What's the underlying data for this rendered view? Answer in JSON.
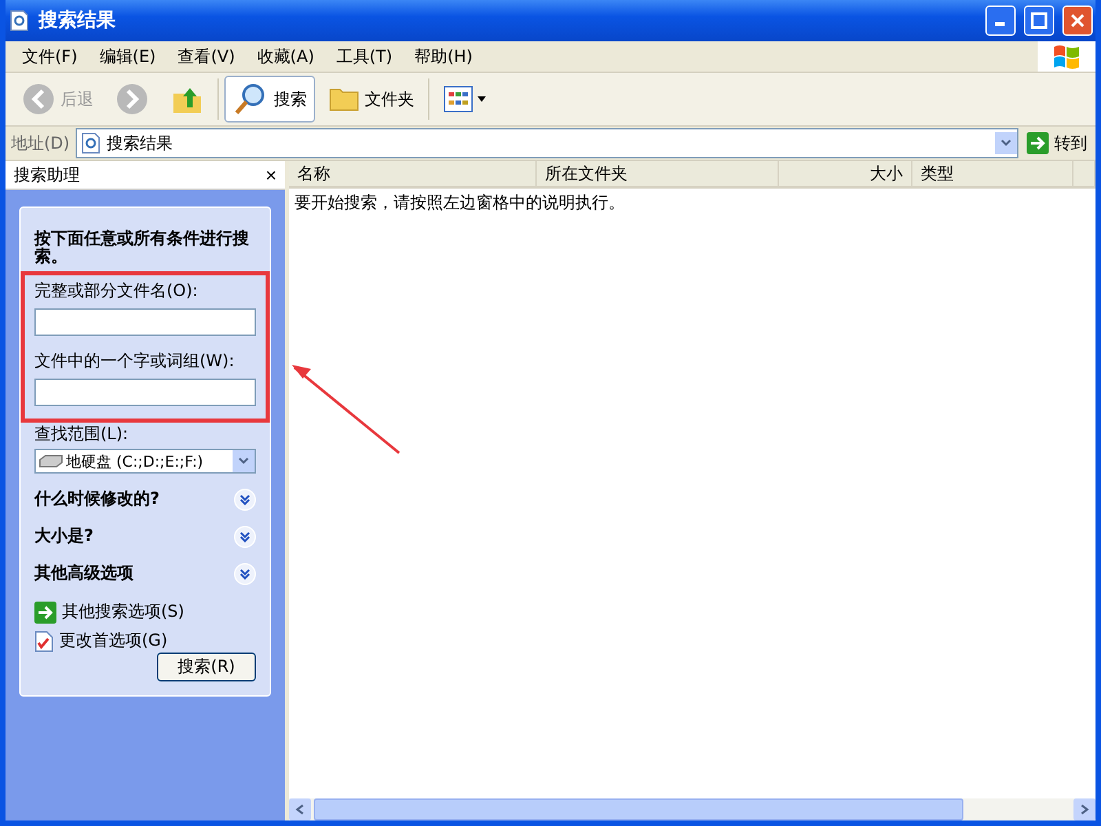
{
  "window": {
    "title": "搜索结果"
  },
  "menu": [
    {
      "label": "文件(F)"
    },
    {
      "label": "编辑(E)"
    },
    {
      "label": "查看(V)"
    },
    {
      "label": "收藏(A)"
    },
    {
      "label": "工具(T)"
    },
    {
      "label": "帮助(H)"
    }
  ],
  "toolbar": [
    {
      "kind": "back",
      "label": "后退",
      "disabled": true,
      "selected": false
    },
    {
      "kind": "forward",
      "disabled": true,
      "selected": false
    },
    {
      "kind": "up",
      "selected": false
    },
    {
      "kind": "search",
      "label": "搜索",
      "disabled": false,
      "selected": true
    },
    {
      "kind": "folders",
      "label": "文件夹",
      "disabled": false,
      "selected": false
    },
    {
      "kind": "views",
      "selected": false
    }
  ],
  "address": {
    "label": "地址(D)",
    "value": "搜索结果",
    "go": "转到"
  },
  "search_pane": {
    "title": "搜索助理",
    "close": "×",
    "heading": "按下面任意或所有条件进行搜索。",
    "fields": [
      {
        "label": "完整或部分文件名(O):"
      },
      {
        "label": "文件中的一个字或词组(W):"
      }
    ],
    "location": {
      "label": "查找范围(L):",
      "value": "地硬盘 (C:;D:;E:;F:)"
    },
    "sections": [
      {
        "label": "什么时候修改的?",
        "expanded": false
      },
      {
        "label": "大小是?",
        "expanded": false
      },
      {
        "label": "其他高级选项",
        "expanded": false
      }
    ],
    "links": [
      {
        "kind": "arrow",
        "label": "其他搜索选项(S)"
      },
      {
        "kind": "prefs",
        "label": "更改首选项(G)"
      }
    ],
    "button": "搜索(R)"
  },
  "results": {
    "columns": [
      {
        "label": "名称",
        "kind": "text"
      },
      {
        "label": "所在文件夹",
        "kind": "text"
      },
      {
        "label": "大小",
        "kind": "number"
      },
      {
        "label": "类型",
        "kind": "text"
      }
    ],
    "message": "要开始搜索，请按照左边窗格中的说明执行。"
  }
}
